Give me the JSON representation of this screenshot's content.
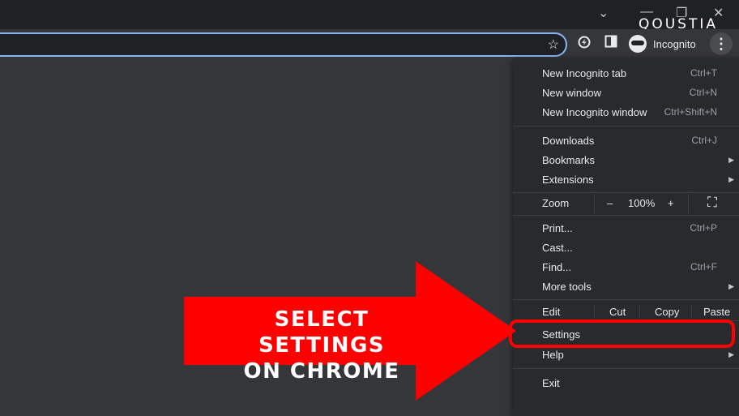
{
  "window": {
    "minimize": "—",
    "restore": "❐",
    "close": "✕",
    "tabs_dropdown": "⌄"
  },
  "brand": "QOUSTIA",
  "toolbar": {
    "profile_label": "Incognito",
    "star": "☆",
    "menu_glyph": "⋮"
  },
  "menu": {
    "new_incognito_tab": {
      "label": "New Incognito tab",
      "shortcut": "Ctrl+T"
    },
    "new_window": {
      "label": "New window",
      "shortcut": "Ctrl+N"
    },
    "new_incognito_window": {
      "label": "New Incognito window",
      "shortcut": "Ctrl+Shift+N"
    },
    "downloads": {
      "label": "Downloads",
      "shortcut": "Ctrl+J"
    },
    "bookmarks": {
      "label": "Bookmarks"
    },
    "extensions": {
      "label": "Extensions"
    },
    "zoom": {
      "label": "Zoom",
      "minus": "–",
      "value": "100%",
      "plus": "+",
      "fullscreen": "⛶"
    },
    "print": {
      "label": "Print...",
      "shortcut": "Ctrl+P"
    },
    "cast": {
      "label": "Cast..."
    },
    "find": {
      "label": "Find...",
      "shortcut": "Ctrl+F"
    },
    "more_tools": {
      "label": "More tools"
    },
    "edit": {
      "label": "Edit",
      "cut": "Cut",
      "copy": "Copy",
      "paste": "Paste"
    },
    "settings": {
      "label": "Settings"
    },
    "help": {
      "label": "Help"
    },
    "exit": {
      "label": "Exit"
    }
  },
  "callout": {
    "line1": "SELECT SETTINGS",
    "line2": "ON CHROME"
  },
  "colors": {
    "highlight": "#ff0000",
    "accent": "#8ab4f8",
    "menu_bg": "#292a2d"
  }
}
